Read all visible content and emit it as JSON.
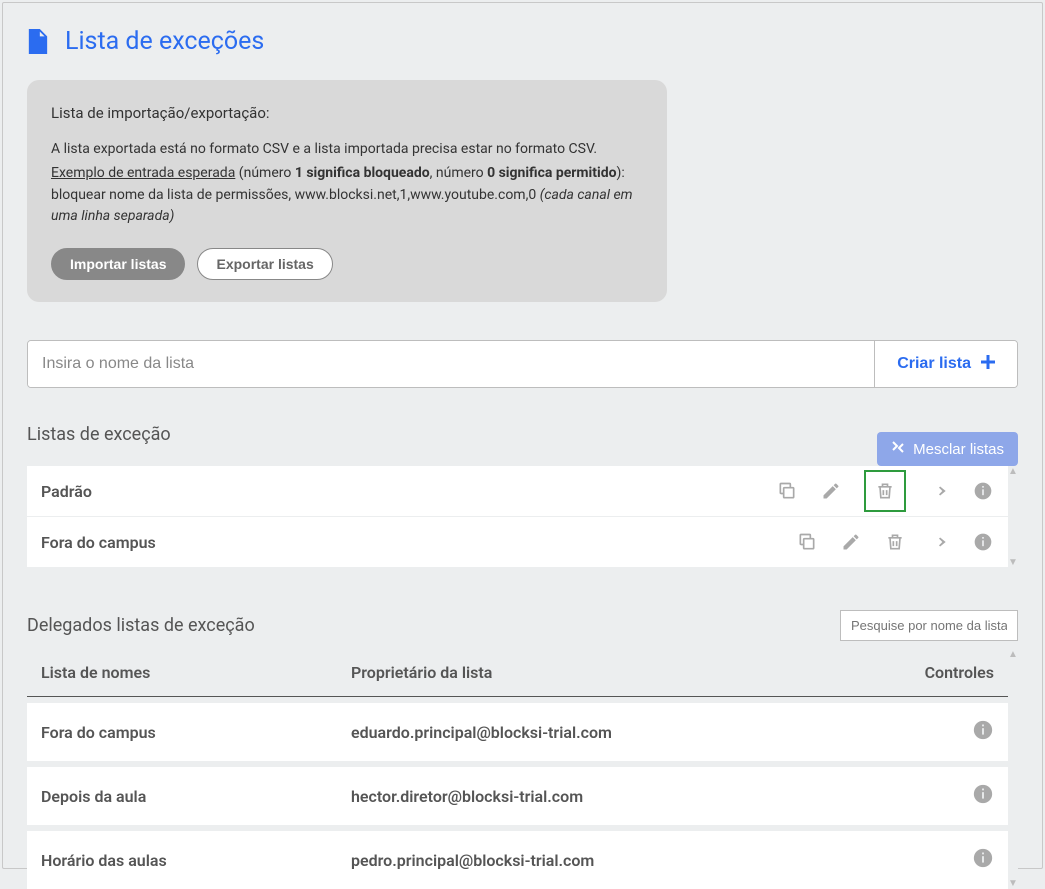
{
  "page": {
    "title": "Lista de exceções"
  },
  "infobox": {
    "heading": "Lista de importação/exportação:",
    "line1_a": "A lista exportada está no formato CSV e a lista importada precisa estar no formato CSV.",
    "line2_link": "Exemplo de entrada esperada",
    "line2_b": " (número ",
    "line2_c": "1 significa bloqueado",
    "line2_d": ", número ",
    "line2_e": "0 significa permitido",
    "line2_f": "):",
    "line3_a": "bloquear nome da lista de permissões, www.blocksi.net,1,www.youtube.com,0   ",
    "line3_em": "(cada canal em uma linha separada)",
    "import_btn": "Importar listas",
    "export_btn": "Exportar listas"
  },
  "create": {
    "placeholder": "Insira o nome da lista",
    "button": "Criar lista"
  },
  "exceptions": {
    "title": "Listas de exceção",
    "merge_btn": "Mesclar listas",
    "rows": [
      {
        "name": "Padrão",
        "highlight_delete": true
      },
      {
        "name": "Fora do campus",
        "highlight_delete": false
      }
    ]
  },
  "delegates": {
    "title": "Delegados listas de exceção",
    "search_placeholder": "Pesquise por nome da lista ou",
    "col_name": "Lista de nomes",
    "col_owner": "Proprietário da lista",
    "col_controls": "Controles",
    "rows": [
      {
        "name": "Fora do campus",
        "owner": "eduardo.principal@blocksi-trial.com"
      },
      {
        "name": "Depois da aula",
        "owner": "hector.diretor@blocksi-trial.com"
      },
      {
        "name": "Horário das aulas",
        "owner": "pedro.principal@blocksi-trial.com"
      }
    ]
  }
}
